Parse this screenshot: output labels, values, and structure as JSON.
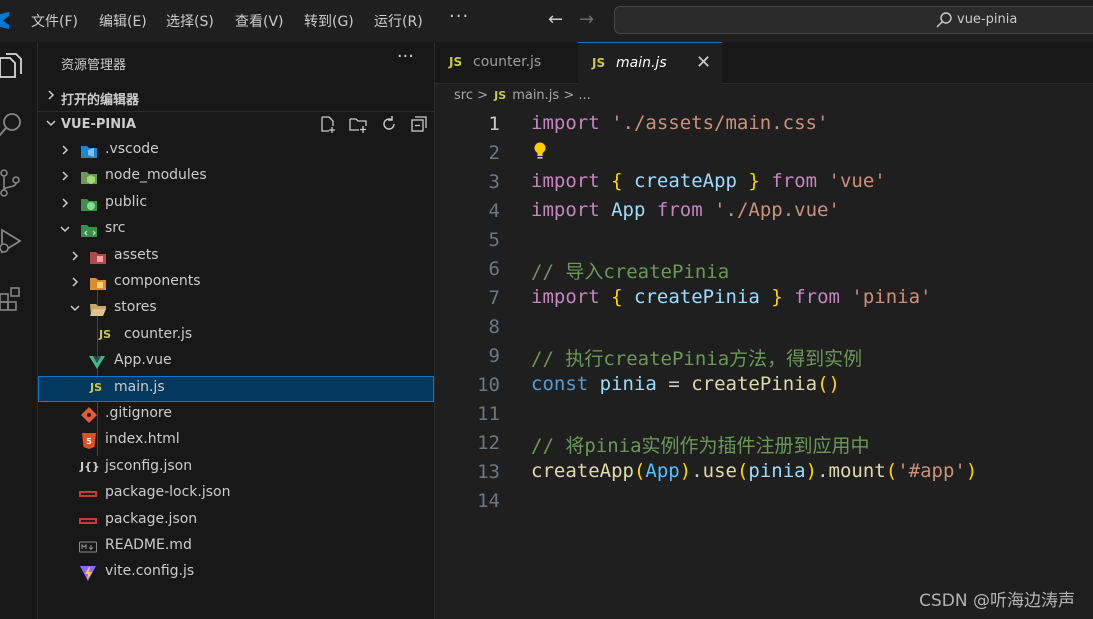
{
  "menu": [
    "文件(F)",
    "编辑(E)",
    "选择(S)",
    "查看(V)",
    "转到(G)",
    "运行(R)"
  ],
  "menu_more": "···",
  "search": {
    "text": "vue-pinia"
  },
  "explorer": {
    "title": "资源管理器",
    "more": "···",
    "open_editors": "打开的编辑器",
    "root": "VUE-PINIA",
    "files": {
      "vscode": ".vscode",
      "node_modules": "node_modules",
      "public": "public",
      "src": "src",
      "assets": "assets",
      "components": "components",
      "stores": "stores",
      "counter": "counter.js",
      "app_vue": "App.vue",
      "main": "main.js",
      "gitignore": ".gitignore",
      "index_html": "index.html",
      "jsconfig": "jsconfig.json",
      "package_lock": "package-lock.json",
      "package_json": "package.json",
      "readme": "README.md",
      "vite_config": "vite.config.js"
    }
  },
  "tabs": [
    {
      "badge": "JS",
      "label": "counter.js"
    },
    {
      "badge": "JS",
      "label": "main.js",
      "close": "✕"
    }
  ],
  "breadcrumb": {
    "part1": "src",
    "sep": ">",
    "badge": "JS",
    "part2": "main.js",
    "part3": "..."
  },
  "code": {
    "line_numbers": [
      "1",
      "2",
      "3",
      "4",
      "5",
      "6",
      "7",
      "8",
      "9",
      "10",
      "11",
      "12",
      "13",
      "14"
    ],
    "l1": {
      "kw": "import",
      "str": "'./assets/main.css'"
    },
    "l3": {
      "kw": "import",
      "open": "{",
      "name": "createApp",
      "close": "}",
      "from": "from",
      "str": "'vue'"
    },
    "l4": {
      "kw": "import",
      "name": "App",
      "from": "from",
      "str": "'./App.vue'"
    },
    "l6": {
      "comment": "// 导入createPinia"
    },
    "l7": {
      "kw": "import",
      "open": "{",
      "name": "createPinia",
      "close": "}",
      "from": "from",
      "str": "'pinia'"
    },
    "l9": {
      "comment": "// 执行createPinia方法，得到实例"
    },
    "l10": {
      "kw": "const",
      "name": "pinia",
      "eq": "=",
      "fn": "createPinia",
      "parens": "()"
    },
    "l12": {
      "comment": "// 将pinia实例作为插件注册到应用中"
    },
    "l13": {
      "fn1": "createApp",
      "p1o": "(",
      "arg1": "App",
      "p1c": ")",
      "dot1": ".",
      "fn2": "use",
      "p2o": "(",
      "arg2": "pinia",
      "p2c": ")",
      "dot2": ".",
      "fn3": "mount",
      "p3o": "(",
      "arg3": "'#app'",
      "p3c": ")"
    }
  },
  "watermark": "CSDN @听海边涛声"
}
